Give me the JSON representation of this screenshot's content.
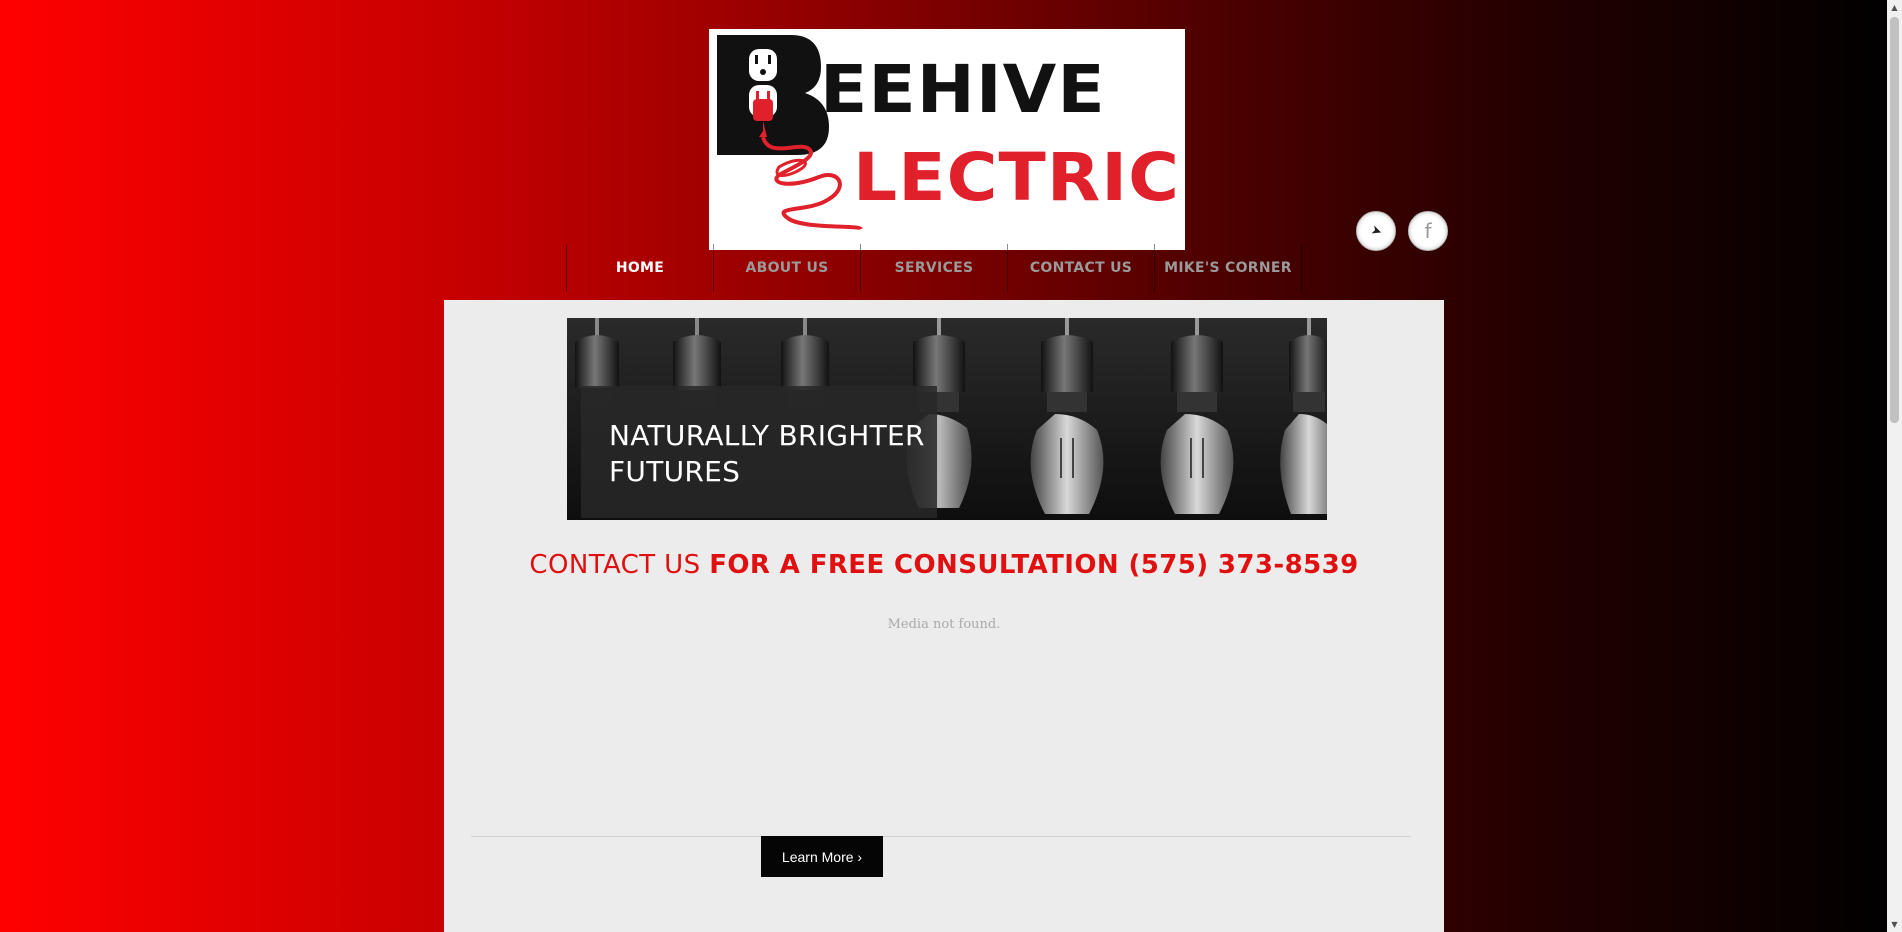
{
  "logo": {
    "word1": "EEHIVE",
    "word2": "LECTRIC",
    "initial": "B",
    "icon": "outlet-plug-icon",
    "word1_color": "#111111",
    "word2_color": "#e0202a"
  },
  "social": {
    "twitter_icon": "twitter-bird-icon",
    "twitter_glyph": "➤",
    "facebook_icon": "facebook-icon",
    "facebook_glyph": "f"
  },
  "nav": {
    "items": [
      {
        "label": "HOME",
        "active": true
      },
      {
        "label": "ABOUT US",
        "active": false
      },
      {
        "label": "SERVICES",
        "active": false
      },
      {
        "label": "CONTACT US",
        "active": false
      },
      {
        "label": "MIKE'S CORNER",
        "active": false
      }
    ]
  },
  "banner": {
    "caption": "NATURALLY BRIGHTER FUTURES",
    "image": "hanging-light-bulbs-icon"
  },
  "cta": {
    "light": "CONTACT US ",
    "bold": "FOR A FREE CONSULTATION (575) 373-8539",
    "color": "#e01010"
  },
  "media": {
    "message": "Media not found."
  },
  "learn_more": {
    "label": "Learn More ›"
  },
  "colors": {
    "background_left": "#ff0000",
    "background_right": "#000000",
    "content_bg": "#ececec"
  }
}
